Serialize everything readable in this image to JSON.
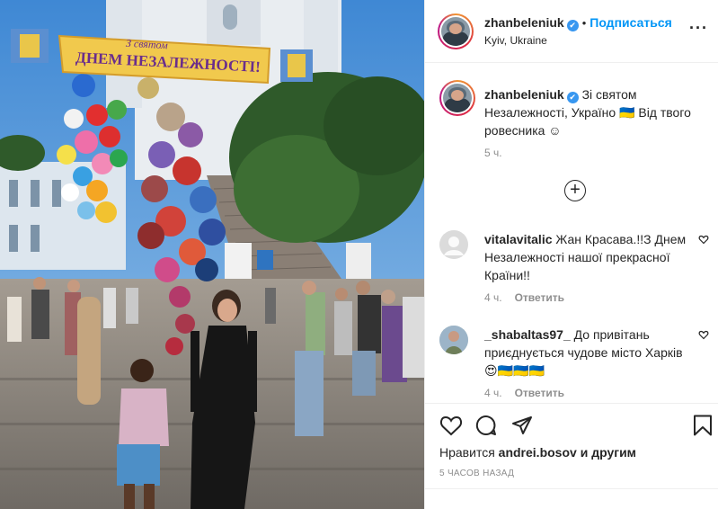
{
  "photo": {
    "banner_text_line1": "З святом",
    "banner_text_line2": "ДНЕМ НЕЗАЛЕЖНОСТІ!"
  },
  "header": {
    "username": "zhanbeleniuk",
    "verified_mark": "✔",
    "separator": "•",
    "follow_label": "Подписаться",
    "location": "Kyiv, Ukraine",
    "more_label": "···"
  },
  "caption": {
    "username": "zhanbeleniuk",
    "verified_mark": "✔",
    "text": "Зі святом Незалежності, Україно 🇺🇦 Від твого ровесника ☺",
    "age": "5 ч."
  },
  "load_more": {
    "label": "+"
  },
  "comments": [
    {
      "username": "vitalavitalic",
      "text": "Жан Красава.!!З Днем Незалежності нашої прекрасної Країни!!",
      "age": "4 ч.",
      "reply_label": "Ответить"
    },
    {
      "username": "_shabaltas97_",
      "text": "До привітань приєднується чудове місто Харків😍🇺🇦🇺🇦🇺🇦",
      "age": "4 ч.",
      "reply_label": "Ответить"
    }
  ],
  "actions": {
    "likes_prefix": "Нравится",
    "likes_user": "andrei.bosov",
    "likes_suffix": "и другим",
    "timestamp": "5 ЧАСОВ НАЗАД"
  },
  "icons": {
    "like": "heart-icon",
    "comment": "comment-bubble-icon",
    "share": "paper-plane-icon",
    "save": "bookmark-icon"
  },
  "colors": {
    "link_blue": "#0095f6",
    "verified_blue": "#3897f0",
    "muted_gray": "#8e8e8e",
    "text": "#262626"
  }
}
